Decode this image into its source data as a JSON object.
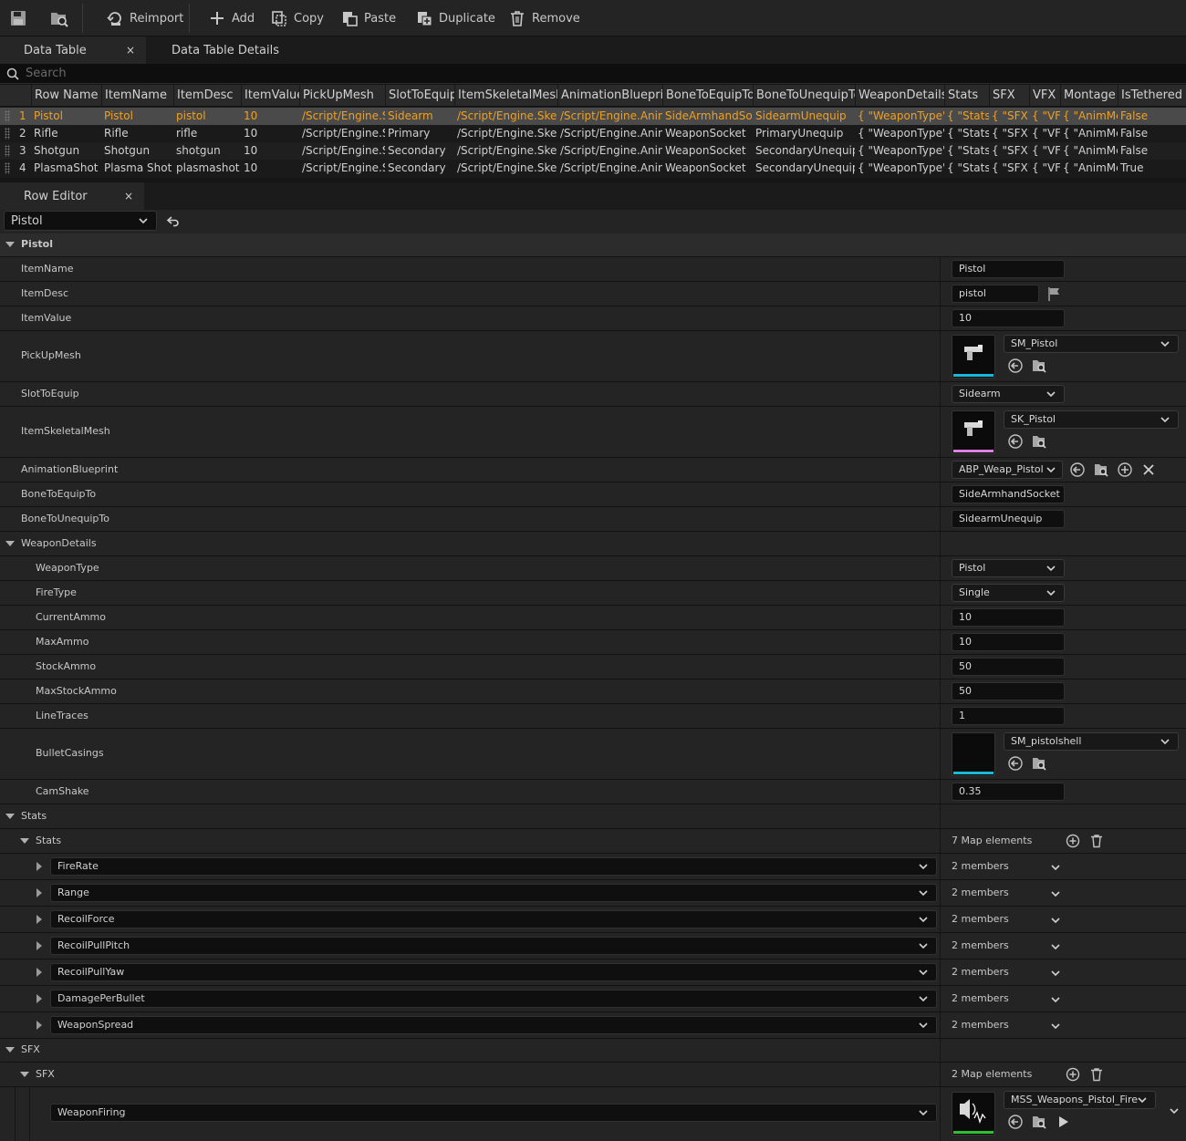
{
  "toolbar": {
    "reimport": "Reimport",
    "add": "Add",
    "copy": "Copy",
    "paste": "Paste",
    "duplicate": "Duplicate",
    "remove": "Remove"
  },
  "tabs": {
    "data_table": "Data Table",
    "data_table_details": "Data Table Details",
    "row_editor": "Row Editor",
    "close_glyph": "×"
  },
  "search": {
    "placeholder": "Search"
  },
  "table": {
    "columns": [
      "Row Name",
      "ItemName",
      "ItemDesc",
      "ItemValue",
      "PickUpMesh",
      "SlotToEquip",
      "ItemSkeletalMesh",
      "AnimationBlueprint",
      "BoneToEquipTo",
      "BoneToUnequipTo",
      "WeaponDetails",
      "Stats",
      "SFX",
      "VFX",
      "Montage",
      "IsTethered"
    ],
    "rows": [
      [
        "1",
        "Pistol",
        "Pistol",
        "pistol",
        "10",
        "/Script/Engine.S",
        "Sidearm",
        "/Script/Engine.Skel",
        "/Script/Engine.Anim",
        "SideArmhandSoc",
        "SidearmUnequip",
        "{ \"WeaponType\":",
        "{ \"Stats'",
        "{ \"SFX\"",
        "{ \"VF",
        "{ \"AnimMc",
        "False"
      ],
      [
        "2",
        "Rifle",
        "Rifle",
        "rifle",
        "10",
        "/Script/Engine.S",
        "Primary",
        "/Script/Engine.Skel",
        "/Script/Engine.Anim",
        "WeaponSocket",
        "PrimaryUnequip",
        "{ \"WeaponType\":",
        "{ \"Stats'",
        "{ \"SFX\"",
        "{ \"VF",
        "{ \"AnimMc",
        "False"
      ],
      [
        "3",
        "Shotgun",
        "Shotgun",
        "shotgun",
        "10",
        "/Script/Engine.S",
        "Secondary",
        "/Script/Engine.Skel",
        "/Script/Engine.Anim",
        "WeaponSocket",
        "SecondaryUnequip",
        "{ \"WeaponType\":",
        "{ \"Stats'",
        "{ \"SFX\"",
        "{ \"VF",
        "{ \"AnimMc",
        "False"
      ],
      [
        "4",
        "PlasmaShot",
        "Plasma Shot",
        "plasmashot",
        "10",
        "/Script/Engine.S",
        "Secondary",
        "/Script/Engine.Skel",
        "/Script/Engine.Anim",
        "WeaponSocket",
        "SecondaryUnequip",
        "{ \"WeaponType\":",
        "{ \"Stats'",
        "{ \"SFX\"",
        "{ \"VF",
        "{ \"AnimMc",
        "True"
      ]
    ]
  },
  "row_editor": {
    "selected_row": "Pistol",
    "category": "Pistol",
    "props": {
      "item_name": {
        "label": "ItemName",
        "value": "Pistol"
      },
      "item_desc": {
        "label": "ItemDesc",
        "value": "pistol"
      },
      "item_value": {
        "label": "ItemValue",
        "value": "10"
      },
      "pickup_mesh": {
        "label": "PickUpMesh",
        "value": "SM_Pistol"
      },
      "slot_to_equip": {
        "label": "SlotToEquip",
        "value": "Sidearm"
      },
      "item_skeletal_mesh": {
        "label": "ItemSkeletalMesh",
        "value": "SK_Pistol"
      },
      "animation_blueprint": {
        "label": "AnimationBlueprint",
        "value": "ABP_Weap_Pistol"
      },
      "bone_to_equip": {
        "label": "BoneToEquipTo",
        "value": "SideArmhandSocket"
      },
      "bone_to_unequip": {
        "label": "BoneToUnequipTo",
        "value": "SidearmUnequip"
      }
    },
    "weapon_details": {
      "label": "WeaponDetails",
      "weapon_type": {
        "label": "WeaponType",
        "value": "Pistol"
      },
      "fire_type": {
        "label": "FireType",
        "value": "Single"
      },
      "current_ammo": {
        "label": "CurrentAmmo",
        "value": "10"
      },
      "max_ammo": {
        "label": "MaxAmmo",
        "value": "10"
      },
      "stock_ammo": {
        "label": "StockAmmo",
        "value": "50"
      },
      "max_stock_ammo": {
        "label": "MaxStockAmmo",
        "value": "50"
      },
      "line_traces": {
        "label": "LineTraces",
        "value": "1"
      },
      "bullet_casings": {
        "label": "BulletCasings",
        "value": "SM_pistolshell"
      },
      "cam_shake": {
        "label": "CamShake",
        "value": "0.35"
      }
    },
    "stats_category": "Stats",
    "stats": {
      "label": "Stats",
      "count": "7 Map elements",
      "entries": [
        {
          "key": "FireRate",
          "value": "2 members"
        },
        {
          "key": "Range",
          "value": "2 members"
        },
        {
          "key": "RecoilForce",
          "value": "2 members"
        },
        {
          "key": "RecoilPullPitch",
          "value": "2 members"
        },
        {
          "key": "RecoilPullYaw",
          "value": "2 members"
        },
        {
          "key": "DamagePerBullet",
          "value": "2 members"
        },
        {
          "key": "WeaponSpread",
          "value": "2 members"
        }
      ]
    },
    "sfx_category": "SFX",
    "sfx": {
      "label": "SFX",
      "count": "2 Map elements",
      "entry_key": "WeaponFiring",
      "entry_value": "MSS_Weapons_Pistol_Fire"
    }
  },
  "colors": {
    "selected_row_text": "#f0a020",
    "mesh_bar": "#18b8d8",
    "skeletal_bar": "#e080e0",
    "sound_bar": "#2ec02e"
  }
}
